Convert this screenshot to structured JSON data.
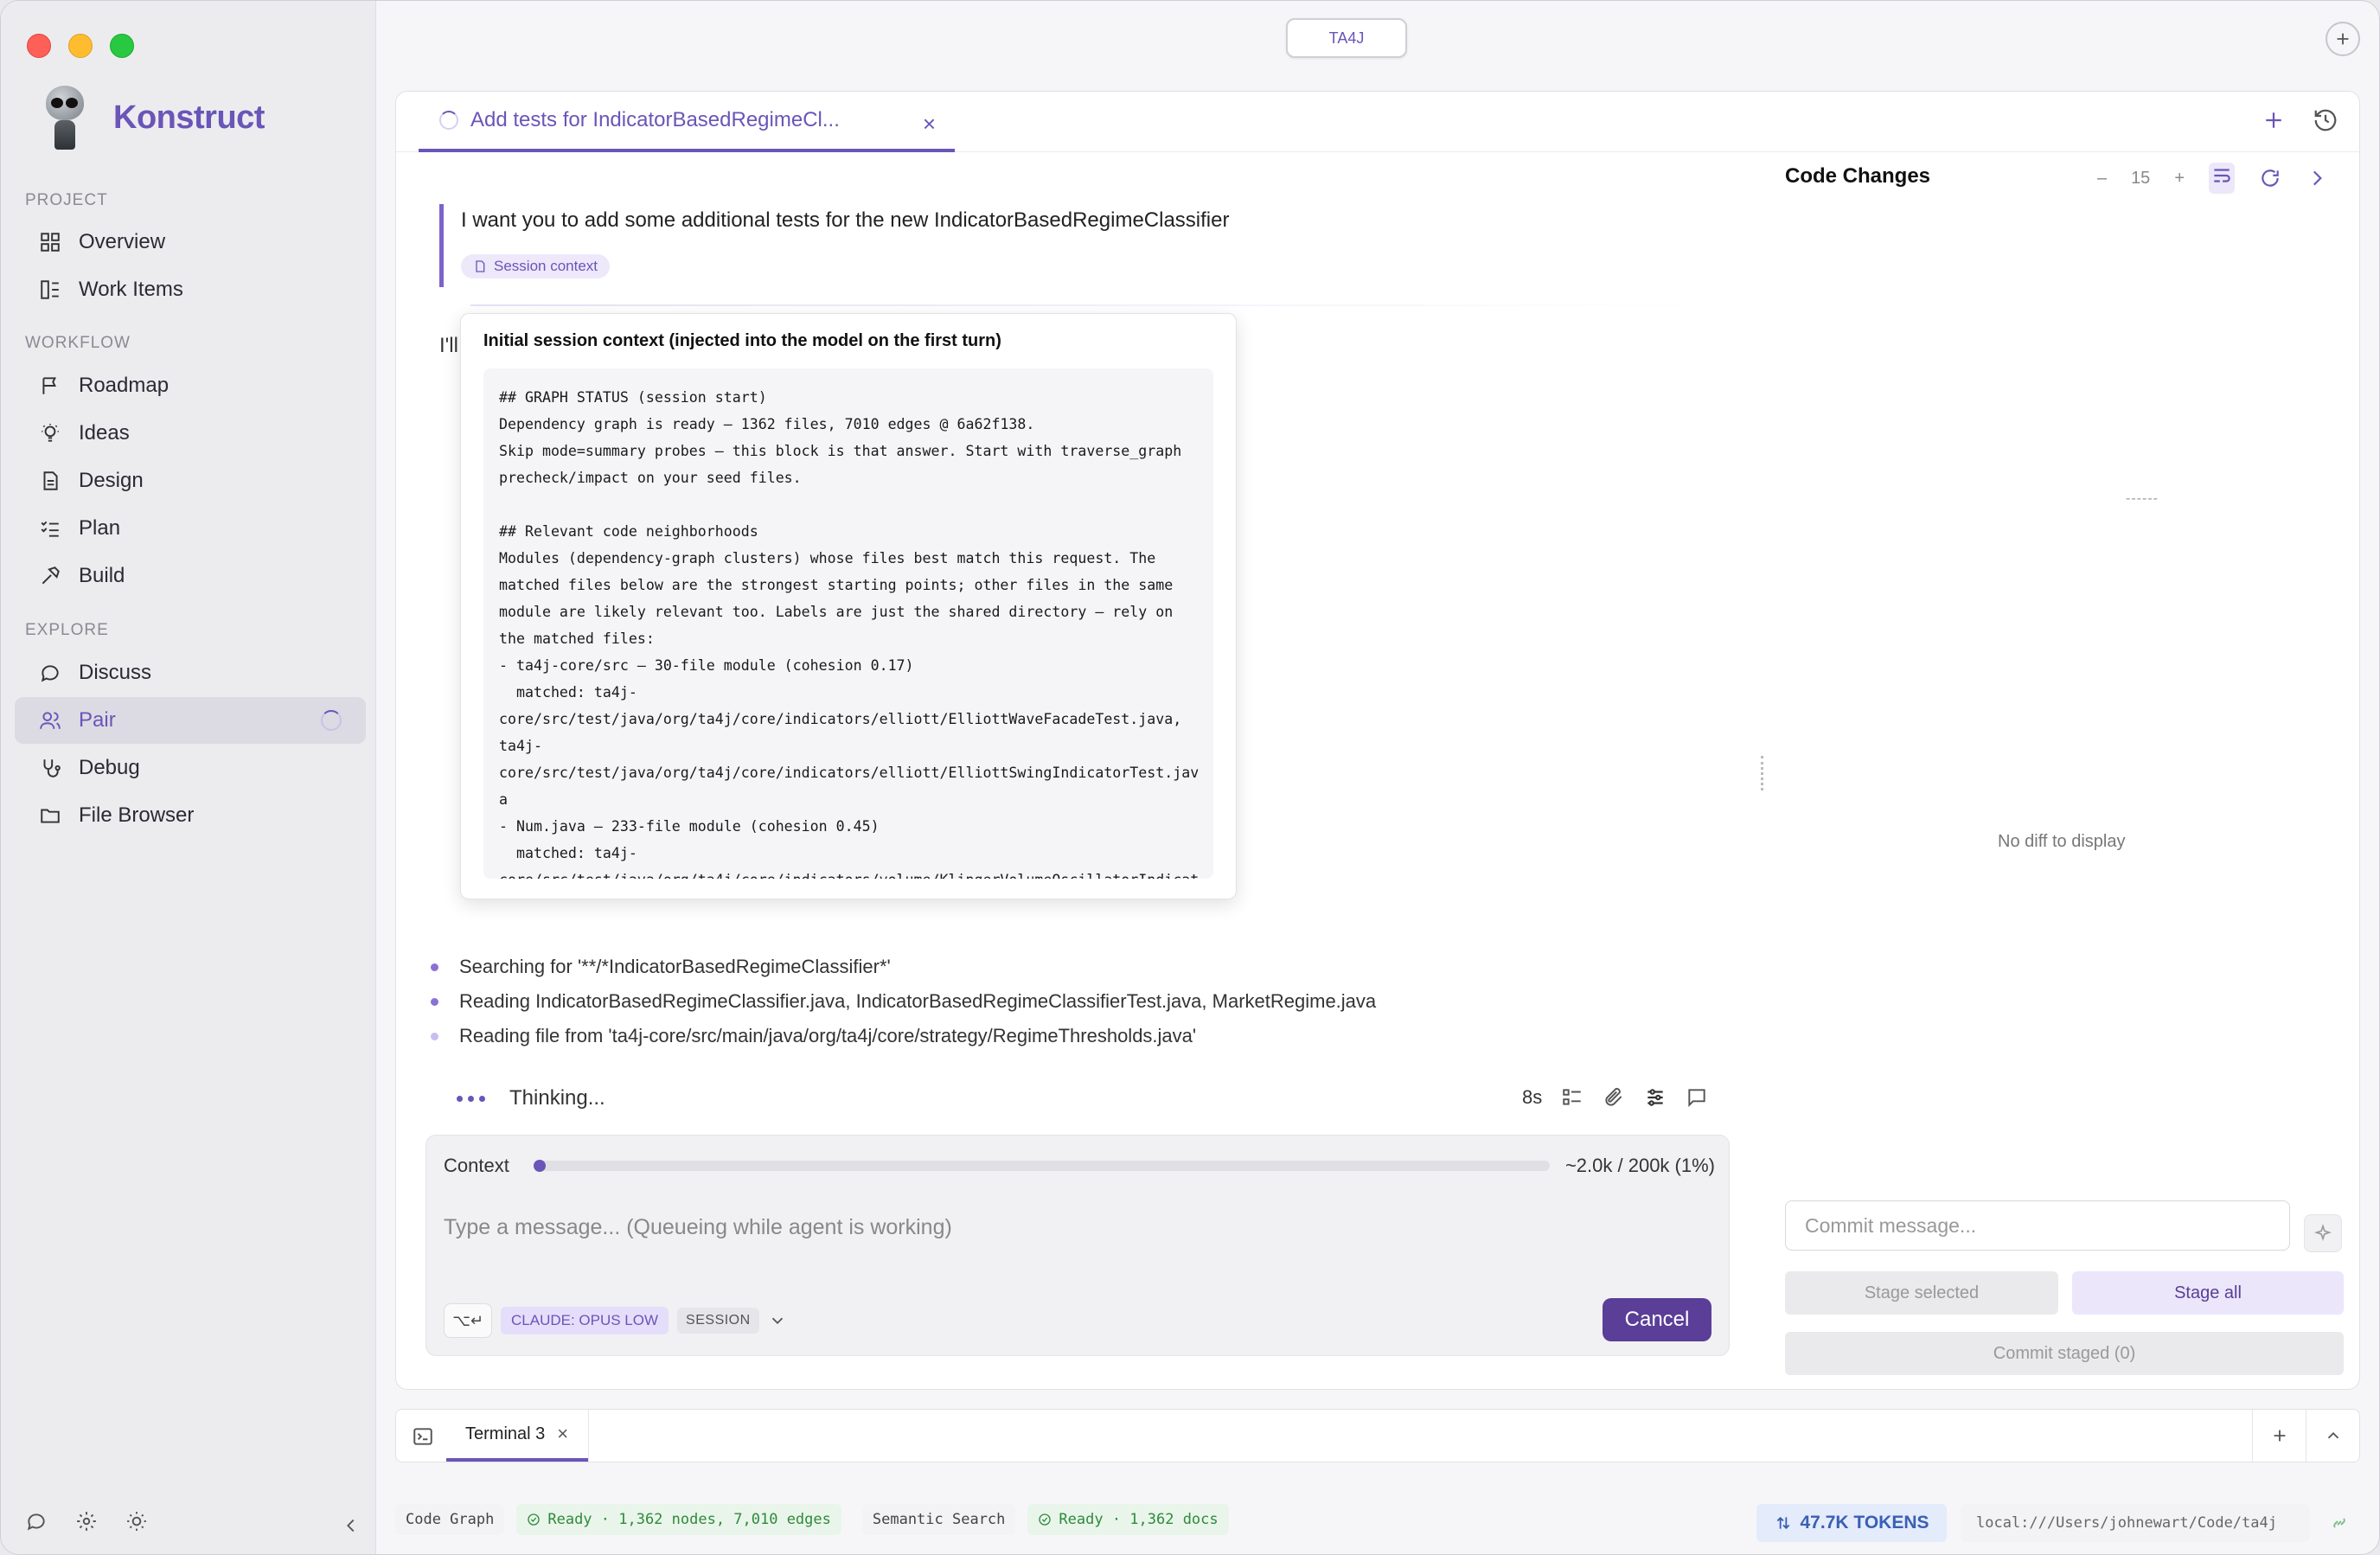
{
  "app": {
    "name": "Konstruct",
    "project_pill": "TA4J"
  },
  "sidebar": {
    "sections": {
      "project": "PROJECT",
      "workflow": "WORKFLOW",
      "explore": "EXPLORE"
    },
    "items": [
      {
        "label": "Overview",
        "icon": "grid-icon"
      },
      {
        "label": "Work Items",
        "icon": "work-items-icon"
      },
      {
        "label": "Roadmap",
        "icon": "flag-icon"
      },
      {
        "label": "Ideas",
        "icon": "lightbulb-icon"
      },
      {
        "label": "Design",
        "icon": "document-icon"
      },
      {
        "label": "Plan",
        "icon": "checklist-icon"
      },
      {
        "label": "Build",
        "icon": "hammer-icon"
      },
      {
        "label": "Discuss",
        "icon": "chat-icon"
      },
      {
        "label": "Pair",
        "icon": "users-icon",
        "active": true
      },
      {
        "label": "Debug",
        "icon": "stethoscope-icon"
      },
      {
        "label": "File Browser",
        "icon": "folder-icon"
      }
    ]
  },
  "tab": {
    "title": "Add tests for IndicatorBasedRegimeCl...",
    "close": "×"
  },
  "chat": {
    "user_message": "I want you to add some additional tests for the new IndicatorBasedRegimeClassifier",
    "context_badge": "Session context",
    "assistant_partial": "I'll",
    "popover": {
      "title": "Initial session context (injected into the model on the first turn)",
      "code": "## GRAPH STATUS (session start)\nDependency graph is ready — 1362 files, 7010 edges @ 6a62f138.\nSkip mode=summary probes — this block is that answer. Start with traverse_graph\nprecheck/impact on your seed files.\n\n## Relevant code neighborhoods\nModules (dependency-graph clusters) whose files best match this request. The\nmatched files below are the strongest starting points; other files in the same\nmodule are likely relevant too. Labels are just the shared directory — rely on\nthe matched files:\n- ta4j-core/src — 30-file module (cohesion 0.17)\n  matched: ta4j-\ncore/src/test/java/org/ta4j/core/indicators/elliott/ElliottWaveFacadeTest.java,\nta4j-\ncore/src/test/java/org/ta4j/core/indicators/elliott/ElliottSwingIndicatorTest.jav\na\n- Num.java — 233-file module (cohesion 0.45)\n  matched: ta4j-\ncore/src/test/java/org/ta4j/core/indicators/volume/KlingerVolumeOscillatorIndicat"
    },
    "steps": [
      "Searching for '**/*IndicatorBasedRegimeClassifier*'",
      "Reading IndicatorBasedRegimeClassifier.java, IndicatorBasedRegimeClassifierTest.java, MarketRegime.java",
      "Reading file from 'ta4j-core/src/main/java/org/ta4j/core/strategy/RegimeThresholds.java'"
    ],
    "thinking_label": "Thinking...",
    "elapsed": "8s"
  },
  "composer": {
    "context_label": "Context",
    "context_usage": "~2.0k / 200k (1%)",
    "context_fraction": 0.01,
    "placeholder": "Type a message... (Queueing while agent is working)",
    "shortcut": "⌥↵",
    "model": "CLAUDE: OPUS LOW",
    "session": "SESSION",
    "cancel": "Cancel"
  },
  "code_changes": {
    "title": "Code Changes",
    "context_lines": "15",
    "dashes": "------",
    "empty": "No diff to display",
    "commit_placeholder": "Commit message...",
    "stage_selected": "Stage selected",
    "stage_all": "Stage all",
    "commit_staged": "Commit staged (0)"
  },
  "terminal": {
    "tab": "Terminal 3",
    "close": "×"
  },
  "status_bar": {
    "code_graph_label": "Code Graph",
    "code_graph_status": "Ready · 1,362 nodes, 7,010 edges",
    "semantic_label": "Semantic Search",
    "semantic_status": "Ready · 1,362 docs",
    "tokens": "47.7K TOKENS",
    "path": "local:///Users/johnewart/Code/ta4j"
  },
  "colors": {
    "accent": "#6a55b8",
    "cancel": "#5a3e97",
    "ok": "#2f8a3b",
    "tokens": "#3a5fb5"
  }
}
